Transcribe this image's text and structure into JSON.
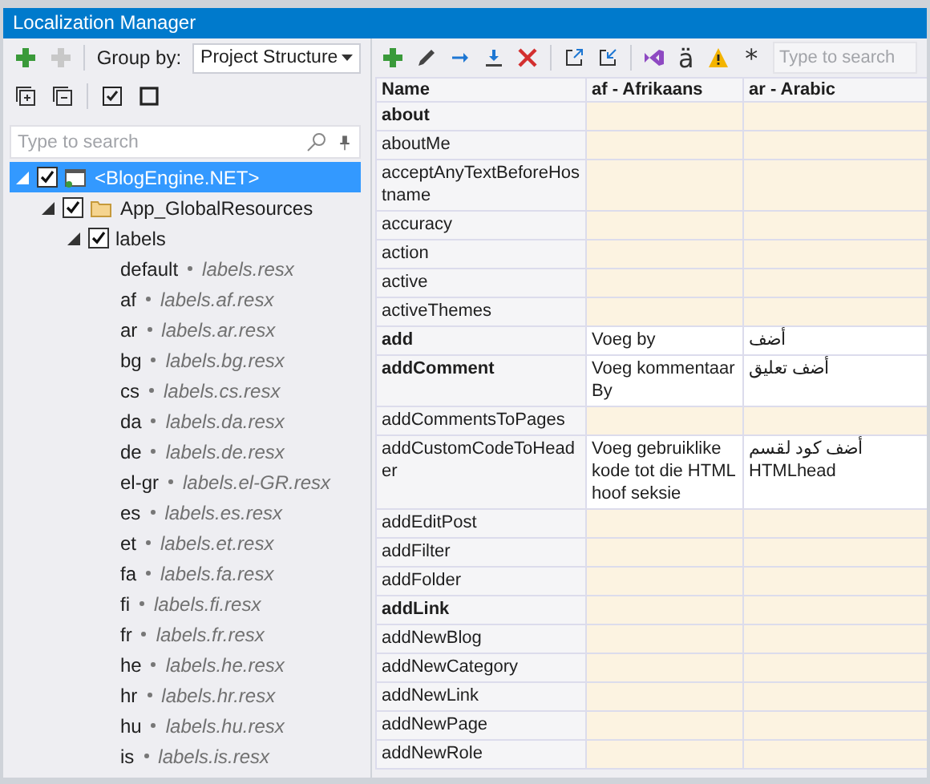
{
  "window": {
    "title": "Localization Manager"
  },
  "left_toolbar": {
    "group_by_label": "Group by:",
    "group_by": "Project Structure"
  },
  "tree_search": {
    "placeholder": "Type to search"
  },
  "tree": [
    {
      "label": "<BlogEngine.NET>",
      "kind": "project",
      "checked": true,
      "expanded": true,
      "selected": true,
      "children": [
        {
          "label": "App_GlobalResources",
          "kind": "folder",
          "checked": true,
          "expanded": true,
          "selected": false,
          "children": [
            {
              "label": "labels",
              "checked": true,
              "expanded": true,
              "selected": false,
              "children": [
                {
                  "kind": "file",
                  "label": "default",
                  "file": "labels.resx",
                  "selected": false
                },
                {
                  "kind": "file",
                  "label": "af",
                  "file": "labels.af.resx",
                  "selected": false
                },
                {
                  "kind": "file",
                  "label": "ar",
                  "file": "labels.ar.resx",
                  "selected": false
                },
                {
                  "kind": "file",
                  "label": "bg",
                  "file": "labels.bg.resx",
                  "selected": false
                },
                {
                  "kind": "file",
                  "label": "cs",
                  "file": "labels.cs.resx",
                  "selected": false
                },
                {
                  "kind": "file",
                  "label": "da",
                  "file": "labels.da.resx",
                  "selected": false
                },
                {
                  "kind": "file",
                  "label": "de",
                  "file": "labels.de.resx",
                  "selected": false
                },
                {
                  "kind": "file",
                  "label": "el-gr",
                  "file": "labels.el-GR.resx",
                  "selected": false
                },
                {
                  "kind": "file",
                  "label": "es",
                  "file": "labels.es.resx",
                  "selected": false
                },
                {
                  "kind": "file",
                  "label": "et",
                  "file": "labels.et.resx",
                  "selected": false
                },
                {
                  "kind": "file",
                  "label": "fa",
                  "file": "labels.fa.resx",
                  "selected": false
                },
                {
                  "kind": "file",
                  "label": "fi",
                  "file": "labels.fi.resx",
                  "selected": false
                },
                {
                  "kind": "file",
                  "label": "fr",
                  "file": "labels.fr.resx",
                  "selected": false
                },
                {
                  "kind": "file",
                  "label": "he",
                  "file": "labels.he.resx",
                  "selected": false
                },
                {
                  "kind": "file",
                  "label": "hr",
                  "file": "labels.hr.resx",
                  "selected": false
                },
                {
                  "kind": "file",
                  "label": "hu",
                  "file": "labels.hu.resx",
                  "selected": false
                },
                {
                  "kind": "file",
                  "label": "is",
                  "file": "labels.is.resx",
                  "selected": false
                }
              ]
            }
          ]
        }
      ]
    }
  ],
  "grid_toolbar": {
    "letter": "ä",
    "star": "*",
    "search": {
      "placeholder": "Type to search"
    }
  },
  "table": {
    "columns": [
      "Name",
      "af - Afrikaans",
      "ar - Arabic"
    ],
    "rows": [
      {
        "name": "about",
        "bold": true
      },
      {
        "name": "aboutMe",
        "bold": false
      },
      {
        "name": "acceptAnyTextBeforeHostname",
        "bold": false
      },
      {
        "name": "accuracy",
        "bold": false
      },
      {
        "name": "action",
        "bold": false
      },
      {
        "name": "active",
        "bold": false
      },
      {
        "name": "activeThemes",
        "bold": false
      },
      {
        "name": "add",
        "bold": true,
        "afrikaans": "Voeg by",
        "arabic": "أضف"
      },
      {
        "name": "addComment",
        "bold": true,
        "afrikaans": "Voeg kommentaar By",
        "arabic": "أضف تعليق"
      },
      {
        "name": "addCommentsToPages",
        "bold": false
      },
      {
        "name": "addCustomCodeToHeader",
        "bold": false,
        "afrikaans": "Voeg gebruiklike kode tot die HTML hoof seksie",
        "arabic": "أضف كود لقسم HTMLhead"
      },
      {
        "name": "addEditPost",
        "bold": false
      },
      {
        "name": "addFilter",
        "bold": false
      },
      {
        "name": "addFolder",
        "bold": false
      },
      {
        "name": "addLink",
        "bold": true
      },
      {
        "name": "addNewBlog",
        "bold": false
      },
      {
        "name": "addNewCategory",
        "bold": false
      },
      {
        "name": "addNewLink",
        "bold": false
      },
      {
        "name": "addNewPage",
        "bold": false
      },
      {
        "name": "addNewRole",
        "bold": false
      }
    ]
  }
}
